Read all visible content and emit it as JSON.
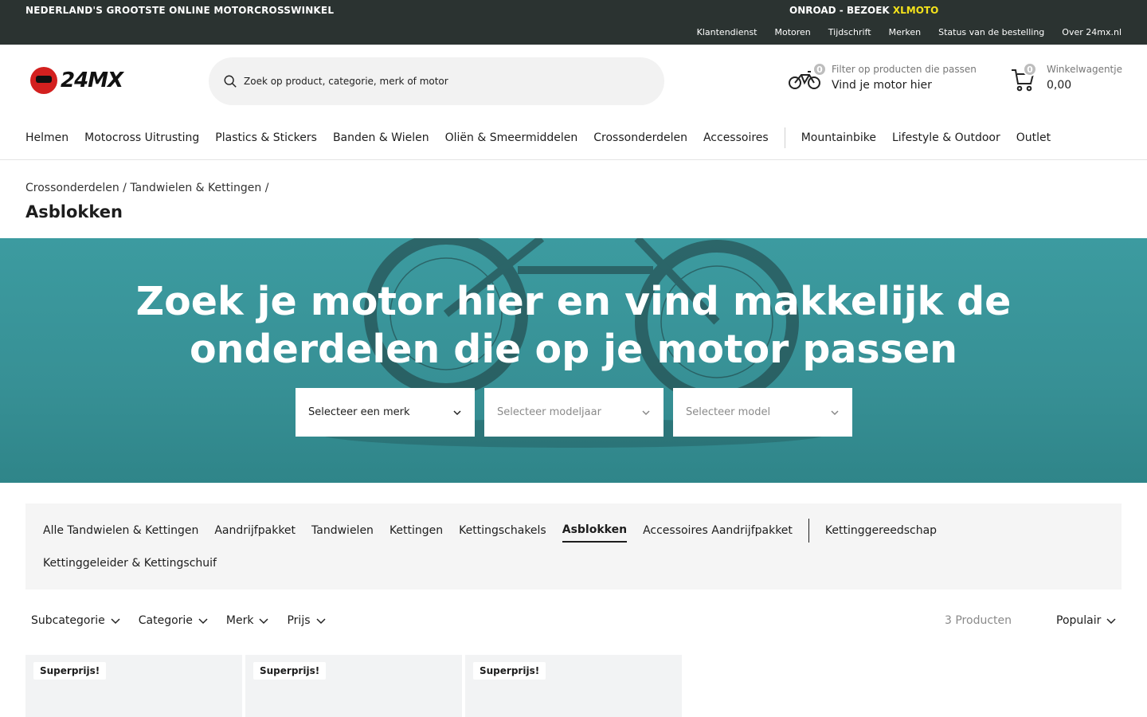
{
  "topbar": {
    "tagline": "NEDERLAND'S GROOTSTE ONLINE MOTORCROSSWINKEL",
    "promo_prefix": "ONROAD - BEZOEK ",
    "promo_highlight": "XLMOTO",
    "links": [
      "Klantendienst",
      "Motoren",
      "Tijdschrift",
      "Merken",
      "Status van de bestelling",
      "Over 24mx.nl"
    ]
  },
  "header": {
    "logo_text": "24MX",
    "search_placeholder": "Zoek op product, categorie, merk of motor",
    "bike_filter": {
      "count": "0",
      "line1": "Filter op producten die passen",
      "line2": "Vind je motor hier"
    },
    "cart": {
      "count": "0",
      "line1": "Winkelwagentje",
      "line2": "0,00"
    }
  },
  "mainnav": {
    "items": [
      "Helmen",
      "Motocross Uitrusting",
      "Plastics & Stickers",
      "Banden & Wielen",
      "Oliën & Smeermiddelen",
      "Crossonderdelen",
      "Accessoires"
    ],
    "items2": [
      "Mountainbike",
      "Lifestyle & Outdoor",
      "Outlet"
    ]
  },
  "breadcrumb": {
    "items": [
      "Crossonderdelen",
      "Tandwielen & Kettingen"
    ],
    "separator": "/"
  },
  "page_title": "Asblokken",
  "hero": {
    "line1": "Zoek je motor hier en vind makkelijk de",
    "line2": "onderdelen die op je motor passen",
    "selects": [
      "Selecteer een merk",
      "Selecteer modeljaar",
      "Selecteer model"
    ]
  },
  "subcategories": {
    "row1": [
      "Alle Tandwielen & Kettingen",
      "Aandrijfpakket",
      "Tandwielen",
      "Kettingen",
      "Kettingschakels",
      "Asblokken",
      "Accessoires Aandrijfpakket"
    ],
    "row1_after_sep": "Kettinggereedschap",
    "row2": "Kettinggeleider & Kettingschuif",
    "active": "Asblokken"
  },
  "filters": [
    "Subcategorie",
    "Categorie",
    "Merk",
    "Prijs"
  ],
  "product_count": "3 Producten",
  "sort_label": "Populair",
  "products": [
    {
      "tag": "Superprijs!"
    },
    {
      "tag": "Superprijs!"
    },
    {
      "tag": "Superprijs!"
    }
  ],
  "colors": {
    "topbar": "#2b3331",
    "promo_highlight": "#f4e21c",
    "hero": "#3a979c",
    "logo_red": "#d3201f"
  }
}
